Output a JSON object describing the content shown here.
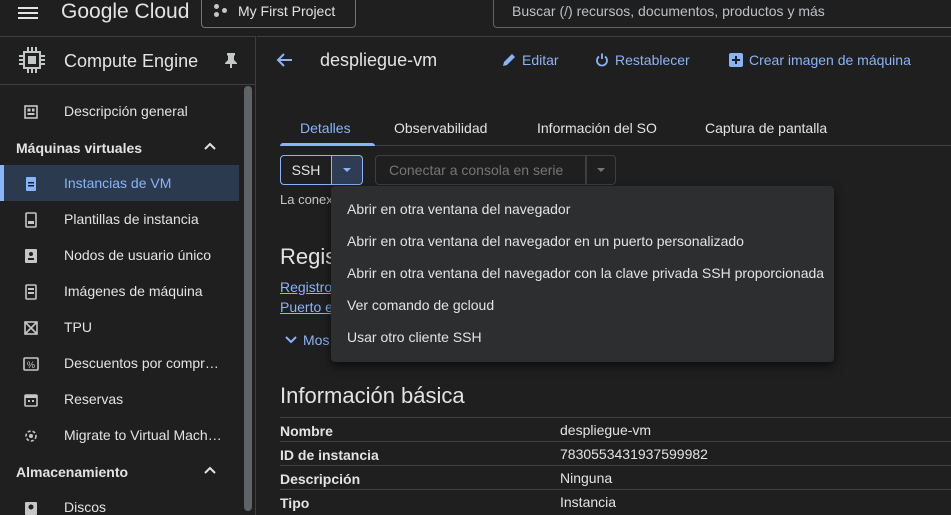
{
  "topbar": {
    "logo_text": "Google Cloud",
    "project_label": "My First Project",
    "search_placeholder": "Buscar (/) recursos, documentos, productos y más"
  },
  "sidebar": {
    "product_title": "Compute Engine",
    "items_top": [
      {
        "label": "Descripción general",
        "icon": "dashboard-icon"
      }
    ],
    "section_vms": "Máquinas virtuales",
    "vm_items": [
      {
        "label": "Instancias de VM",
        "icon": "vm-instance-icon",
        "active": true
      },
      {
        "label": "Plantillas de instancia",
        "icon": "template-icon"
      },
      {
        "label": "Nodos de usuario único",
        "icon": "sole-tenant-icon"
      },
      {
        "label": "Imágenes de máquina",
        "icon": "machine-image-icon"
      },
      {
        "label": "TPU",
        "icon": "tpu-icon"
      },
      {
        "label": "Descuentos por compr…",
        "icon": "discount-icon"
      },
      {
        "label": "Reservas",
        "icon": "calendar-icon"
      },
      {
        "label": "Migrate to Virtual Mach…",
        "icon": "migrate-icon"
      }
    ],
    "section_storage": "Almacenamiento",
    "storage_items": [
      {
        "label": "Discos",
        "icon": "disk-icon"
      }
    ]
  },
  "header": {
    "vm_name": "despliegue-vm",
    "edit_label": "Editar",
    "reset_label": "Restablecer",
    "create_image_label": "Crear imagen de máquina"
  },
  "tabs": [
    "Detalles",
    "Observabilidad",
    "Información del SO",
    "Captura de pantalla"
  ],
  "ssh": {
    "ssh_label": "SSH",
    "serial_label": "Conectar a consola en serie",
    "conn_text": "La conex",
    "registros_title": "Regis",
    "link1": "Registro",
    "link2": "Puerto e",
    "show_more": "Mos"
  },
  "ssh_menu": [
    "Abrir en otra ventana del navegador",
    "Abrir en otra ventana del navegador en un puerto personalizado",
    "Abrir en otra ventana del navegador con la clave privada SSH proporcionada",
    "Ver comando de gcloud",
    "Usar otro cliente SSH"
  ],
  "basic_info": {
    "title": "Información básica",
    "rows": [
      {
        "key": "Nombre",
        "value": "despliegue-vm"
      },
      {
        "key": "ID de instancia",
        "value": "7830553431937599982"
      },
      {
        "key": "Descripción",
        "value": "Ninguna"
      },
      {
        "key": "Tipo",
        "value": "Instancia"
      }
    ]
  },
  "colors": {
    "accent": "#8ab4f8",
    "background": "#1f1f1f",
    "menu_bg": "#2d2e30",
    "active_bg": "#2b3a4f"
  }
}
